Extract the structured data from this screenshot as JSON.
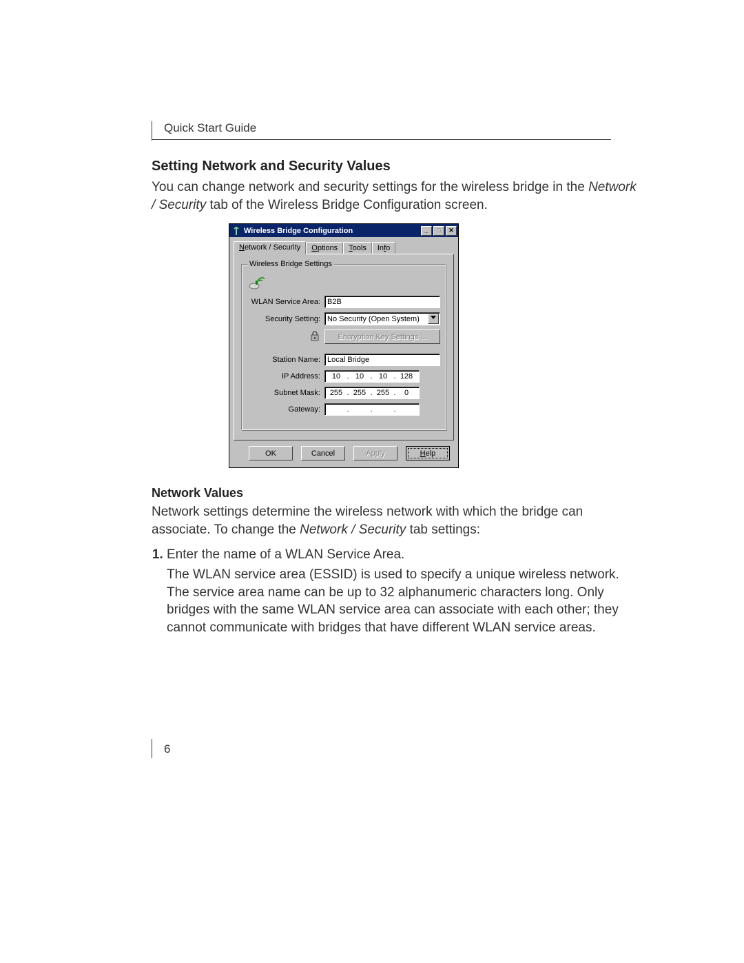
{
  "doc": {
    "guide_title": "Quick Start Guide",
    "page_number": "6",
    "section_heading": "Setting Network and Security Values",
    "intro_pre": "You can change network and security settings for the wireless bridge in the ",
    "intro_italic": "Network / Security",
    "intro_post": " tab of the Wireless Bridge Configuration screen.",
    "sub_heading": "Network Values",
    "sub_body_pre": "Network settings determine the wireless network with which the bridge can associate. To change the ",
    "sub_body_italic": "Network / Security",
    "sub_body_post": " tab settings:",
    "step1_lead": "Enter the name of a WLAN Service Area.",
    "step1_detail": "The WLAN service area (ESSID) is used to specify a unique wireless network. The service area name can be up to 32 alphanumeric characters long. Only bridges with the same WLAN service area can associate with each other; they cannot communicate with bridges that have different WLAN service areas."
  },
  "dialog": {
    "title": "Wireless Bridge Configuration",
    "tabs": {
      "t0_pre": "N",
      "t0_post": "etwork / Security",
      "t1_pre": "O",
      "t1_post": "ptions",
      "t2_pre": "T",
      "t2_post": "ools",
      "t3_pre": "f",
      "t3_pretext": "In",
      "t3_post": "o"
    },
    "group_legend": "Wireless Bridge Settings",
    "labels": {
      "wlan": "WLAN Service Area:",
      "security": "Security Setting:",
      "encryption_btn": "Encryption Key Settings ...",
      "station": "Station Name:",
      "ip": "IP Address:",
      "subnet": "Subnet Mask:",
      "gateway": "Gateway:"
    },
    "values": {
      "wlan": "B2B",
      "security": "No Security (Open System)",
      "station": "Local Bridge",
      "ip": [
        "10",
        "10",
        "10",
        "128"
      ],
      "subnet": [
        "255",
        "255",
        "255",
        "0"
      ],
      "gateway": [
        "",
        "",
        "",
        ""
      ]
    },
    "buttons": {
      "ok": "OK",
      "cancel": "Cancel",
      "apply": "Apply",
      "help_pre": "H",
      "help_post": "elp"
    }
  }
}
